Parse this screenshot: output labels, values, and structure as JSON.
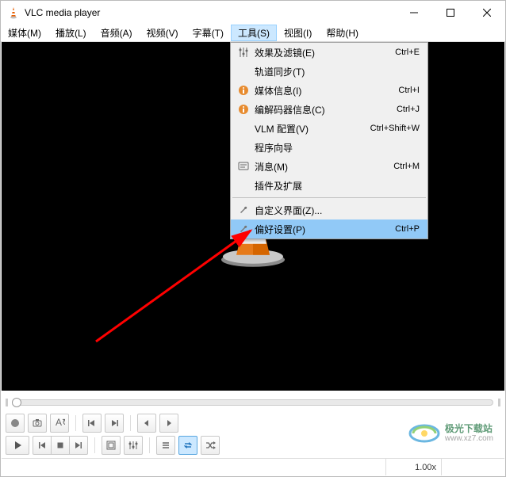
{
  "window": {
    "title": "VLC media player"
  },
  "menubar": {
    "items": [
      {
        "label": "媒体(M)"
      },
      {
        "label": "播放(L)"
      },
      {
        "label": "音频(A)"
      },
      {
        "label": "视频(V)"
      },
      {
        "label": "字幕(T)"
      },
      {
        "label": "工具(S)"
      },
      {
        "label": "视图(I)"
      },
      {
        "label": "帮助(H)"
      }
    ],
    "active_index": 5
  },
  "dropdown": {
    "items": [
      {
        "icon": "sliders",
        "label": "效果及滤镜(E)",
        "shortcut": "Ctrl+E"
      },
      {
        "icon": "",
        "label": "轨道同步(T)",
        "shortcut": ""
      },
      {
        "icon": "info",
        "label": "媒体信息(I)",
        "shortcut": "Ctrl+I"
      },
      {
        "icon": "info",
        "label": "编解码器信息(C)",
        "shortcut": "Ctrl+J"
      },
      {
        "icon": "",
        "label": "VLM 配置(V)",
        "shortcut": "Ctrl+Shift+W"
      },
      {
        "icon": "",
        "label": "程序向导",
        "shortcut": ""
      },
      {
        "icon": "messages",
        "label": "消息(M)",
        "shortcut": "Ctrl+M"
      },
      {
        "icon": "",
        "label": "插件及扩展",
        "shortcut": ""
      },
      {
        "sep": true
      },
      {
        "icon": "wrench",
        "label": "自定义界面(Z)...",
        "shortcut": ""
      },
      {
        "icon": "wrench",
        "label": "偏好设置(P)",
        "shortcut": "Ctrl+P",
        "highlight": true
      }
    ]
  },
  "status": {
    "speed": "1.00x"
  },
  "watermark": {
    "line1": "极光下载站",
    "line2": "www.xz7.com"
  }
}
